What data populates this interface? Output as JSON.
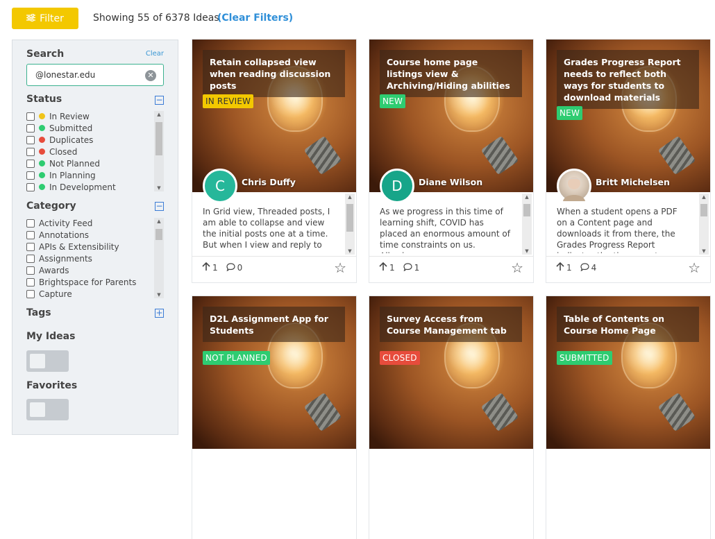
{
  "header": {
    "filter_label": "Filter",
    "showing_text": "Showing 55 of 6378 Ideas",
    "clear_filters": "(Clear Filters)"
  },
  "sidebar": {
    "search": {
      "title": "Search",
      "clear_label": "Clear",
      "value": "@lonestar.edu"
    },
    "status": {
      "title": "Status",
      "items": [
        {
          "label": "In Review",
          "color": "#f0c419"
        },
        {
          "label": "Submitted",
          "color": "#2ecc71"
        },
        {
          "label": "Duplicates",
          "color": "#e74c3c"
        },
        {
          "label": "Closed",
          "color": "#e74c3c"
        },
        {
          "label": "Not Planned",
          "color": "#2ecc71"
        },
        {
          "label": "In Planning",
          "color": "#2ecc71"
        },
        {
          "label": "In Development",
          "color": "#2ecc71"
        }
      ]
    },
    "category": {
      "title": "Category",
      "items": [
        "Activity Feed",
        "Annotations",
        "APIs & Extensibility",
        "Assignments",
        "Awards",
        "Brightspace for Parents",
        "Capture"
      ]
    },
    "tags": {
      "title": "Tags"
    },
    "my_ideas": {
      "title": "My Ideas"
    },
    "favorites": {
      "title": "Favorites"
    }
  },
  "cards": [
    {
      "title": "Retain collapsed view when reading discussion posts",
      "status": "IN REVIEW",
      "status_color": "#f3c800",
      "status_text_color": "#333",
      "author": "Chris Duffy",
      "avatar_letter": "C",
      "avatar_color": "#26b79a",
      "description": "In Grid view, Threaded posts, I am able to collapse and view the initial posts one at a time. But when I view and reply to anyone,",
      "votes": "1",
      "comments": "0"
    },
    {
      "title": "Course home page listings view & Archiving/Hiding abilities",
      "status": "NEW",
      "status_color": "#2ecc71",
      "status_text_color": "#fff",
      "author": "Diane Wilson",
      "avatar_letter": "D",
      "avatar_color": "#17a589",
      "description": "As we progress in this time of learning shift, COVID has placed an enormous amount of time constraints on us. Allowing",
      "votes": "1",
      "comments": "1"
    },
    {
      "title": "Grades Progress Report needs to reflect both ways for students to download materials",
      "status": "NEW",
      "status_color": "#2ecc71",
      "status_text_color": "#fff",
      "author": "Britt Michelsen",
      "avatar_letter": "",
      "avatar_color": "#cbb8a6",
      "description": "When a student opens a PDF on a Content page and downloads it from there, the Grades Progress Report indicates the time spent",
      "votes": "1",
      "comments": "4"
    },
    {
      "title": "D2L Assignment App for Students",
      "status": "NOT PLANNED",
      "status_color": "#2ecc71",
      "status_text_color": "#fff"
    },
    {
      "title": "Survey Access from Course Management tab",
      "status": "CLOSED",
      "status_color": "#e74c3c",
      "status_text_color": "#fff"
    },
    {
      "title": "Table of Contents on Course Home Page",
      "status": "SUBMITTED",
      "status_color": "#2ecc71",
      "status_text_color": "#fff"
    }
  ]
}
